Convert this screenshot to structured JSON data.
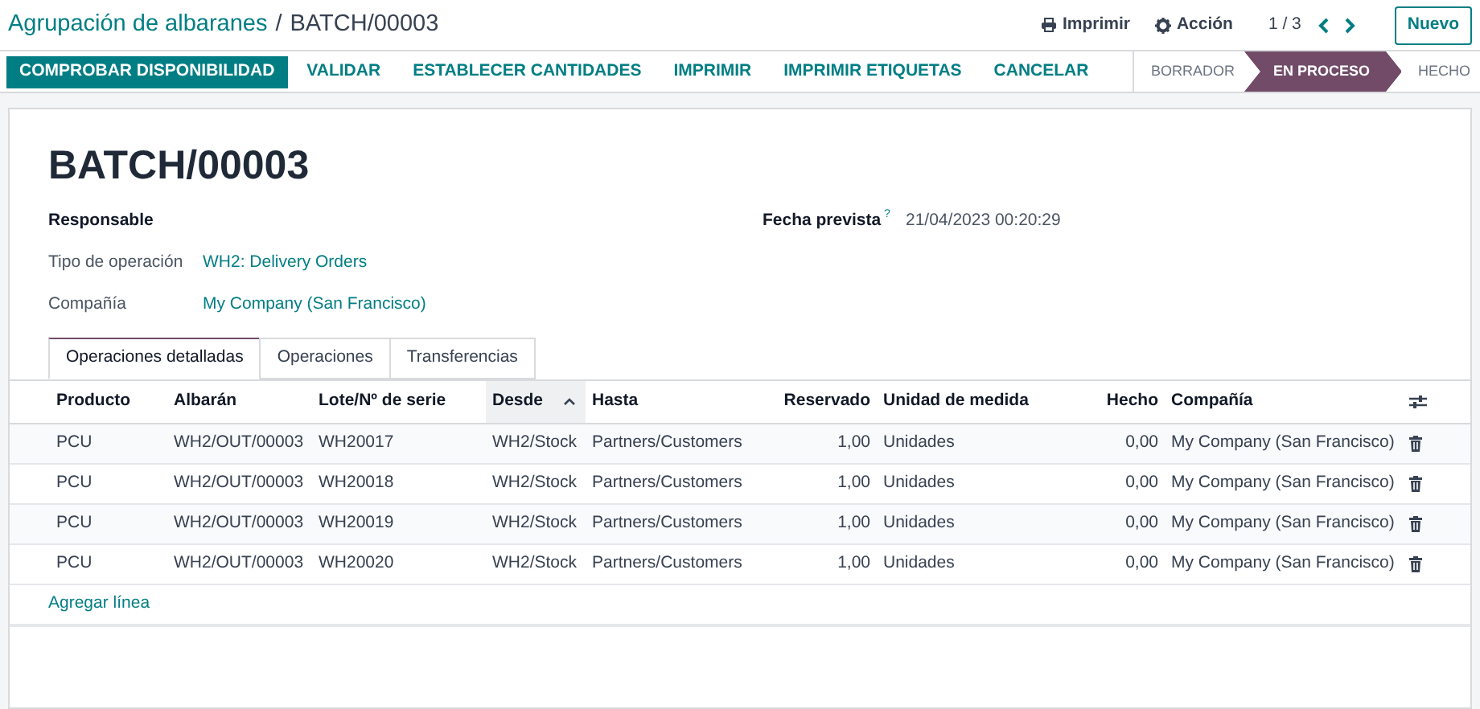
{
  "breadcrumb": {
    "parent": "Agrupación de albaranes",
    "separator": "/",
    "current": "BATCH/00003"
  },
  "top_actions": [
    {
      "kind": "print",
      "label": "Imprimir"
    },
    {
      "kind": "gear",
      "label": "Acción"
    }
  ],
  "pager": "1 / 3",
  "new_button": "Nuevo",
  "action_buttons": [
    {
      "label": "COMPROBAR DISPONIBILIDAD",
      "kind": "primary"
    },
    {
      "label": "VALIDAR",
      "kind": "link"
    },
    {
      "label": "ESTABLECER CANTIDADES",
      "kind": "link"
    },
    {
      "label": "IMPRIMIR",
      "kind": "link"
    },
    {
      "label": "IMPRIMIR ETIQUETAS",
      "kind": "link"
    },
    {
      "label": "CANCELAR",
      "kind": "link"
    }
  ],
  "status_steps": [
    {
      "label": "BORRADOR",
      "selected": false
    },
    {
      "label": "EN PROCESO",
      "selected": true
    },
    {
      "label": "HECHO",
      "selected": false
    }
  ],
  "record_title": "BATCH/00003",
  "fields_left": [
    {
      "label": "Responsable",
      "kind": "required"
    },
    {
      "label": "Tipo de operación",
      "value": "WH2: Delivery Orders",
      "kind": "normal"
    },
    {
      "label": "Compañía",
      "value": "My Company (San Francisco)",
      "kind": "normal"
    }
  ],
  "fields_right": [
    {
      "label": "Fecha prevista",
      "help": "?",
      "value": "21/04/2023 00:20:29"
    }
  ],
  "tabs": [
    {
      "label": "Operaciones detalladas",
      "selected": true
    },
    {
      "label": "Operaciones",
      "selected": false
    },
    {
      "label": "Transferencias",
      "selected": false
    }
  ],
  "table": {
    "columns": [
      {
        "label": "Producto",
        "kind": "text",
        "sorted": false
      },
      {
        "label": "Albarán",
        "kind": "text",
        "sorted": false
      },
      {
        "label": "Lote/Nº de serie",
        "kind": "text",
        "sorted": false
      },
      {
        "label": "Desde",
        "kind": "text",
        "sorted": true
      },
      {
        "label": "Hasta",
        "kind": "text",
        "sorted": false
      },
      {
        "label": "Reservado",
        "kind": "number",
        "sorted": false
      },
      {
        "label": "Unidad de medida",
        "kind": "text",
        "sorted": false
      },
      {
        "label": "Hecho",
        "kind": "number",
        "sorted": false
      },
      {
        "label": "Compañía",
        "kind": "text",
        "sorted": false
      }
    ],
    "rows": [
      [
        "PCU",
        "WH2/OUT/00003",
        "WH20017",
        "WH2/Stock",
        "Partners/Customers",
        "1,00",
        "Unidades",
        "0,00",
        "My Company (San Francisco)"
      ],
      [
        "PCU",
        "WH2/OUT/00003",
        "WH20018",
        "WH2/Stock",
        "Partners/Customers",
        "1,00",
        "Unidades",
        "0,00",
        "My Company (San Francisco)"
      ],
      [
        "PCU",
        "WH2/OUT/00003",
        "WH20019",
        "WH2/Stock",
        "Partners/Customers",
        "1,00",
        "Unidades",
        "0,00",
        "My Company (San Francisco)"
      ],
      [
        "PCU",
        "WH2/OUT/00003",
        "WH20020",
        "WH2/Stock",
        "Partners/Customers",
        "1,00",
        "Unidades",
        "0,00",
        "My Company (San Francisco)"
      ]
    ],
    "add_line": "Agregar línea"
  }
}
